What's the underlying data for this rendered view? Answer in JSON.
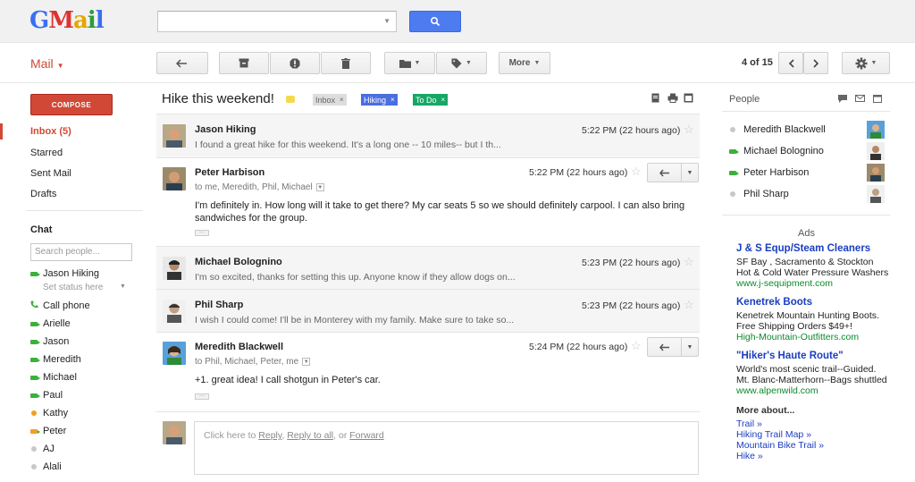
{
  "logo": {
    "g": "G",
    "m": "M",
    "a": "a",
    "i": "i",
    "l": "l"
  },
  "header": {
    "search_value": ""
  },
  "toolbar": {
    "mail_label": "Mail",
    "more_label": "More",
    "pager": "4 of 15"
  },
  "nav": {
    "compose": "COMPOSE",
    "inbox": "Inbox (5)",
    "starred": "Starred",
    "sent": "Sent Mail",
    "drafts": "Drafts"
  },
  "chat": {
    "title": "Chat",
    "search_placeholder": "Search people...",
    "me": "Jason Hiking",
    "status": "Set status here",
    "call_phone": "Call phone",
    "contacts": [
      {
        "name": "Arielle",
        "status": "video"
      },
      {
        "name": "Jason",
        "status": "video"
      },
      {
        "name": "Meredith",
        "status": "video"
      },
      {
        "name": "Michael",
        "status": "video"
      },
      {
        "name": "Paul",
        "status": "video"
      },
      {
        "name": "Kathy",
        "status": "idle"
      },
      {
        "name": "Peter",
        "status": "video-busy"
      },
      {
        "name": "AJ",
        "status": "offline"
      },
      {
        "name": "Alali",
        "status": "offline"
      }
    ]
  },
  "thread": {
    "subject": "Hike this weekend!",
    "labels": [
      {
        "name": "Inbox",
        "bg": "#dddddd",
        "color": "#666666"
      },
      {
        "name": "Hiking",
        "bg": "#4a6ee0",
        "color": "#ffffff"
      },
      {
        "name": "To Do",
        "bg": "#16a765",
        "color": "#ffffff"
      }
    ],
    "messages": [
      {
        "sender": "Jason Hiking",
        "time": "5:22 PM (22 hours ago)",
        "snippet": "I found a great hike for this weekend. It's a long one -- 10 miles-- but I th..."
      },
      {
        "sender": "Peter Harbison",
        "time": "5:22 PM (22 hours ago)",
        "to": "to me, Meredith, Phil, Michael",
        "body1": "I'm definitely in.  How long will it take to get there?  My car seats 5 so we should definitely carpool.  I can also bring",
        "body2": "sandwiches for the group."
      },
      {
        "sender": "Michael Bolognino",
        "time": "5:23 PM (22 hours ago)",
        "snippet": "I'm so excited, thanks for setting this up. Anyone know if they allow dogs on..."
      },
      {
        "sender": "Phil Sharp",
        "time": "5:23 PM (22 hours ago)",
        "snippet": "I wish I could come! I'll be in Monterey with my family. Make sure to take so..."
      },
      {
        "sender": "Meredith Blackwell",
        "time": "5:24 PM (22 hours ago)",
        "to": "to Phil, Michael, Peter, me",
        "body1": "+1. great idea! I call shotgun in Peter's car."
      }
    ],
    "reply": {
      "prefix": "Click here to ",
      "reply": "Reply",
      "sep1": ", ",
      "reply_all": "Reply to all",
      "sep2": ", or ",
      "forward": "Forward"
    }
  },
  "people": {
    "title": "People",
    "list": [
      {
        "name": "Meredith Blackwell",
        "status": "offline"
      },
      {
        "name": "Michael Bolognino",
        "status": "video"
      },
      {
        "name": "Peter Harbison",
        "status": "video"
      },
      {
        "name": "Phil Sharp",
        "status": "offline"
      }
    ]
  },
  "ads": {
    "title": "Ads",
    "items": [
      {
        "title": "J & S Equp/Steam Cleaners",
        "line1": "SF Bay , Sacramento & Stockton",
        "line2": "Hot & Cold Water Pressure Washers",
        "url": "www.j-sequipment.com"
      },
      {
        "title": "Kenetrek Boots",
        "line1": "Kenetrek Mountain Hunting Boots.",
        "line2": "Free Shipping Orders $49+!",
        "url": "High-Mountain-Outfitters.com"
      },
      {
        "title": "\"Hiker's Haute Route\"",
        "line1": "World's most scenic trail--Guided.",
        "line2": "Mt. Blanc-Matterhorn--Bags shuttled",
        "url": "www.alpenwild.com"
      }
    ],
    "more_about": "More about...",
    "more_links": [
      "Trail »",
      "Hiking Trail Map »",
      "Mountain Bike Trail »",
      "Hike »"
    ]
  },
  "colors": {
    "accent_red": "#d14836",
    "search_blue": "#4d7bf0",
    "ad_blue": "#1a3dc1",
    "ad_green": "#0b8a2c"
  }
}
